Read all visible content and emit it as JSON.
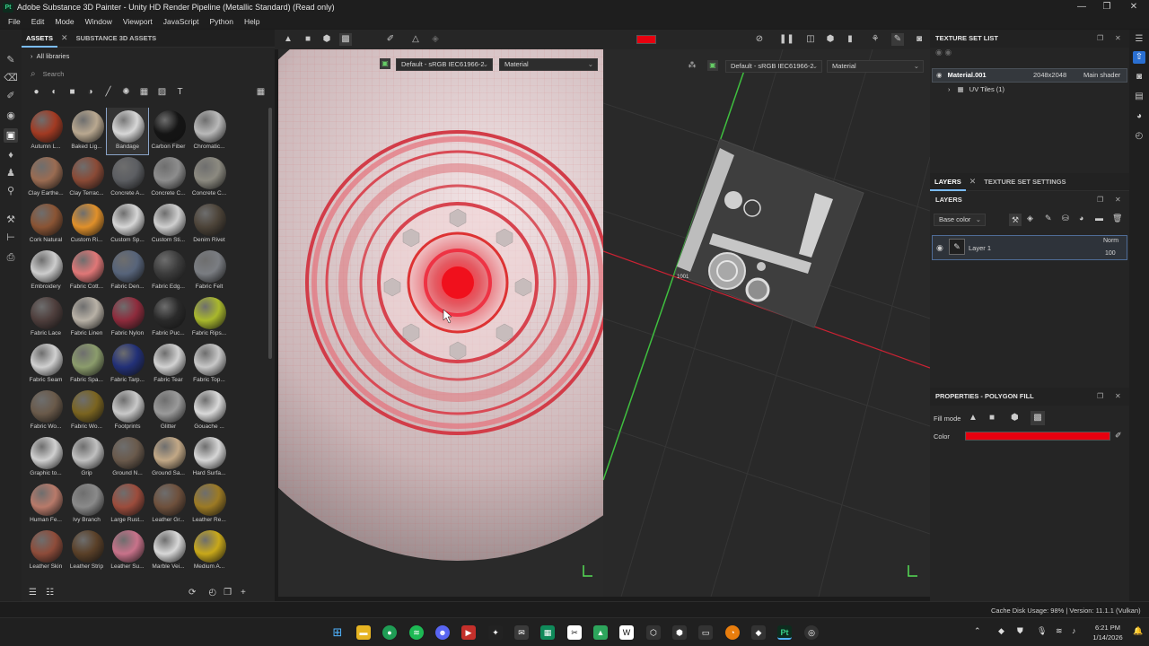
{
  "window": {
    "title": "Adobe Substance 3D Painter - Unity HD Render Pipeline (Metallic Standard) (Read only)",
    "logo": "Pt",
    "controls": [
      "—",
      "❐",
      "✕"
    ]
  },
  "menu": [
    "File",
    "Edit",
    "Mode",
    "Window",
    "Viewport",
    "JavaScript",
    "Python",
    "Help"
  ],
  "assets_panel": {
    "tabs": [
      "ASSETS",
      "SUBSTANCE 3D ASSETS"
    ],
    "library": "All libraries",
    "search_placeholder": "Search",
    "items": [
      {
        "label": "Autumn L...",
        "color": "#a23a22"
      },
      {
        "label": "Baked Lig...",
        "color": "#b9a890"
      },
      {
        "label": "Bandage",
        "color": "#d7d7d7",
        "selected": true
      },
      {
        "label": "Carbon Fiber",
        "color": "#151515"
      },
      {
        "label": "Chromatic...",
        "color": "#b9b9b9"
      },
      {
        "label": "Clay Earthe...",
        "color": "#9a6c52"
      },
      {
        "label": "Clay Terrac...",
        "color": "#8a4a36"
      },
      {
        "label": "Concrete A...",
        "color": "#5c5e62"
      },
      {
        "label": "Concrete C...",
        "color": "#8d8d8d"
      },
      {
        "label": "Concrete C...",
        "color": "#8c8a80"
      },
      {
        "label": "Cork Natural",
        "color": "#8a5434"
      },
      {
        "label": "Custom Ri...",
        "color": "#e0902a"
      },
      {
        "label": "Custom Sp...",
        "color": "#d6d6d6"
      },
      {
        "label": "Custom Sti...",
        "color": "#cfcfcf"
      },
      {
        "label": "Denim Rivet",
        "color": "#4c4338"
      },
      {
        "label": "Embroidery",
        "color": "#cdcdcd"
      },
      {
        "label": "Fabric Cott...",
        "color": "#e07777"
      },
      {
        "label": "Fabric Den...",
        "color": "#57647a"
      },
      {
        "label": "Fabric Edg...",
        "color": "#3c3c3c"
      },
      {
        "label": "Fabric Felt",
        "color": "#7a7d82"
      },
      {
        "label": "Fabric Lace",
        "color": "#4e3e3c"
      },
      {
        "label": "Fabric Linen",
        "color": "#b8b1a6"
      },
      {
        "label": "Fabric Nylon",
        "color": "#8e2b3c"
      },
      {
        "label": "Fabric Puc...",
        "color": "#2a2a2a"
      },
      {
        "label": "Fabric Rips...",
        "color": "#a9b82c"
      },
      {
        "label": "Fabric Seam",
        "color": "#d0d0d0"
      },
      {
        "label": "Fabric Spa...",
        "color": "#8b9c6c"
      },
      {
        "label": "Fabric Tarp...",
        "color": "#223077"
      },
      {
        "label": "Fabric Tear",
        "color": "#d2d2d2"
      },
      {
        "label": "Fabric Top...",
        "color": "#c8c8c8"
      },
      {
        "label": "Fabric Wo...",
        "color": "#6a5a4a"
      },
      {
        "label": "Fabric Wo...",
        "color": "#7a6420"
      },
      {
        "label": "Footprints",
        "color": "#c9c9c9"
      },
      {
        "label": "Glitter",
        "color": "#9a9a9a"
      },
      {
        "label": "Gouache ...",
        "color": "#d9d9d9"
      },
      {
        "label": "Graphic to...",
        "color": "#d0d0d0"
      },
      {
        "label": "Grip",
        "color": "#c0c0c0"
      },
      {
        "label": "Ground N...",
        "color": "#6a5a4c"
      },
      {
        "label": "Ground Sa...",
        "color": "#c2a886"
      },
      {
        "label": "Hard Surfa...",
        "color": "#d6d6d6"
      },
      {
        "label": "Human Fe...",
        "color": "#b87a6a"
      },
      {
        "label": "Ivy Branch",
        "color": "#8a8a8a"
      },
      {
        "label": "Large Rust...",
        "color": "#9c4c3c"
      },
      {
        "label": "Leather Gr...",
        "color": "#6e503c"
      },
      {
        "label": "Leather Re...",
        "color": "#9c7a24"
      },
      {
        "label": "Leather Skin",
        "color": "#8e4c3a"
      },
      {
        "label": "Leather Strip",
        "color": "#5a4028"
      },
      {
        "label": "Leather Su...",
        "color": "#c8728a"
      },
      {
        "label": "Marble Vei...",
        "color": "#d8d8d8"
      },
      {
        "label": "Medium A...",
        "color": "#c8a81a"
      }
    ]
  },
  "viewport": {
    "uv_color_profile": "Default - sRGB IEC61966-2",
    "uv_channel": "Material",
    "color_profile": "Default - sRGB IEC61966-2",
    "channel": "Material",
    "uv_tile_label": "1001",
    "fill_color": "#e8000f"
  },
  "texture_set_list": {
    "header": "TEXTURE SET LIST",
    "material": "Material.001",
    "resolution": "2048x2048",
    "shader": "Main shader",
    "uv_tiles": "UV Tiles (1)"
  },
  "layers": {
    "tabs": [
      "LAYERS",
      "TEXTURE SET SETTINGS"
    ],
    "header": "LAYERS",
    "channel_select": "Base color",
    "layer_name": "Layer 1",
    "blend_mode": "Norm",
    "opacity": "100"
  },
  "properties": {
    "header": "PROPERTIES - POLYGON FILL",
    "fill_mode_label": "Fill mode",
    "color_label": "Color",
    "color_value": "#e8000f"
  },
  "status": {
    "text": "Cache Disk Usage:   98% | Version: 11.1.1 (Vulkan)"
  },
  "taskbar": {
    "time": "6:21 PM",
    "date": "1/14/2026"
  }
}
